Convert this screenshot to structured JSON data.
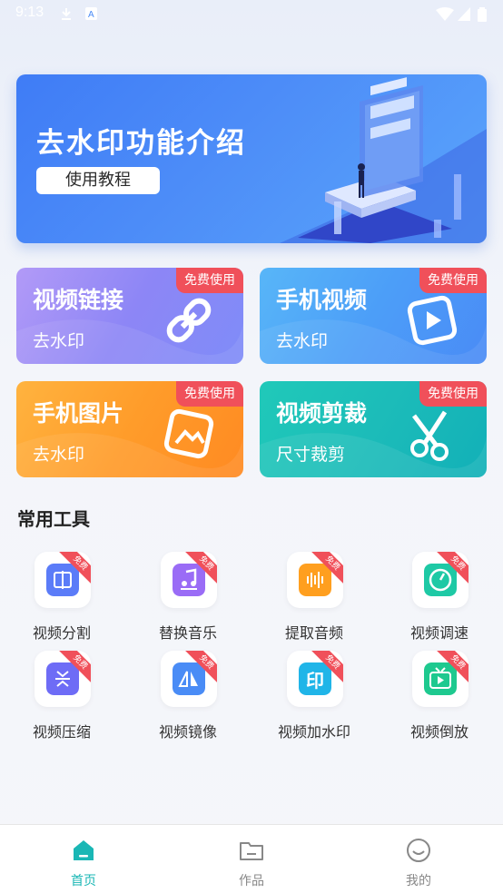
{
  "status_bar": {
    "time": "9:13"
  },
  "banner": {
    "title": "去水印功能介绍",
    "button_label": "使用教程"
  },
  "cards": [
    {
      "title": "视频链接",
      "subtitle": "去水印",
      "badge": "免费使用",
      "icon": "link-icon"
    },
    {
      "title": "手机视频",
      "subtitle": "去水印",
      "badge": "免费使用",
      "icon": "play-icon"
    },
    {
      "title": "手机图片",
      "subtitle": "去水印",
      "badge": "免费使用",
      "icon": "image-icon"
    },
    {
      "title": "视频剪裁",
      "subtitle": "尺寸裁剪",
      "badge": "免费使用",
      "icon": "scissors-icon"
    }
  ],
  "tools_section": {
    "title": "常用工具",
    "ribbon": "免费",
    "items": [
      {
        "label": "视频分割",
        "icon": "split-icon",
        "color": "#5b7cf8"
      },
      {
        "label": "替换音乐",
        "icon": "music-icon",
        "color": "#9a6cf6"
      },
      {
        "label": "提取音频",
        "icon": "audio-wave-icon",
        "color": "#ff9f1f"
      },
      {
        "label": "视频调速",
        "icon": "speed-icon",
        "color": "#1ec9a5"
      },
      {
        "label": "视频压缩",
        "icon": "compress-icon",
        "color": "#6e6cf6"
      },
      {
        "label": "视频镜像",
        "icon": "mirror-icon",
        "color": "#4a8cf6"
      },
      {
        "label": "视频加水印",
        "icon": "watermark-icon",
        "color": "#20b5e8"
      },
      {
        "label": "视频倒放",
        "icon": "tv-play-icon",
        "color": "#1ec98f"
      }
    ]
  },
  "tab_bar": {
    "tabs": [
      {
        "label": "首页",
        "icon": "home-icon",
        "active": true
      },
      {
        "label": "作品",
        "icon": "folder-icon",
        "active": false
      },
      {
        "label": "我的",
        "icon": "smile-icon",
        "active": false
      }
    ]
  },
  "colors": {
    "accent": "#1ab7b5",
    "badge": "#f0505a",
    "banner": "#4d8df8"
  }
}
